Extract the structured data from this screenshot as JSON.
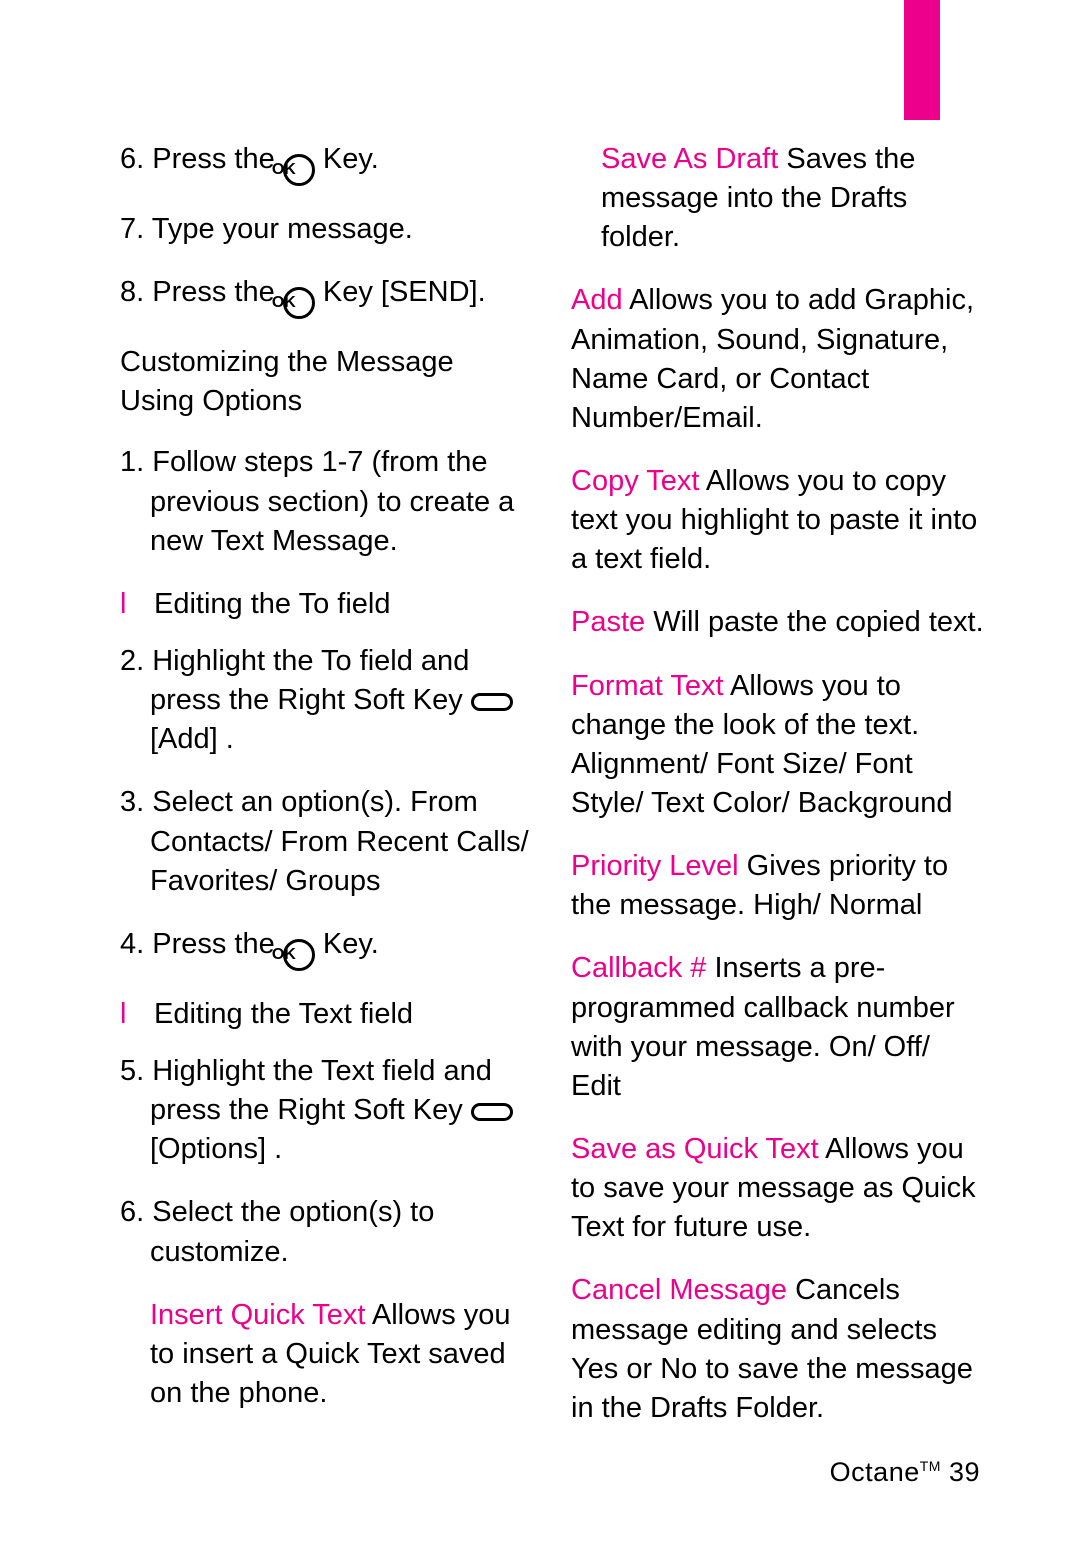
{
  "left": {
    "step6a": "6. Press the ",
    "step6b": " Key.",
    "step7": "7. Type your message.",
    "step8a": "8. Press the ",
    "step8b": " Key ",
    "step8c": "[SEND]",
    "step8d": ".",
    "subhead1": "Customizing the Message Using Options",
    "cstep1": "1. Follow steps 1-7 (from the previous section) to create a new Text Message.",
    "bullet1": "Editing the To field",
    "cstep2a": "2. Highlight the To field and press the Right Soft Key ",
    "cstep2b": " [Add] .",
    "cstep3": "3. Select an option(s). From Contacts/ From Recent Calls/ Favorites/ Groups",
    "cstep4a": "4. Press the ",
    "cstep4b": " Key.",
    "bullet2": "Editing the Text field",
    "cstep5a": "5. Highlight the Text field and press the Right Soft Key ",
    "cstep5b": " [Options] .",
    "cstep6": "6. Select the option(s) to customize.",
    "opt1k": "Insert Quick Text ",
    "opt1v": "Allows you to insert a Quick Text saved on the phone.",
    "opt2k": "Save As Draft  ",
    "opt2v": "Saves the message into the Drafts folder."
  },
  "right": {
    "opt3k": "Add ",
    "opt3v": " Allows you to add Graphic, Animation, Sound, Signature, Name Card, or Contact Number/Email.",
    "opt4k": "Copy Text ",
    "opt4v": "Allows you to copy text you highlight to paste it into a text field.",
    "opt5k": "Paste ",
    "opt5v": "Will paste the copied text.",
    "opt6k": "Format Text ",
    "opt6v": "Allows you to change the look of the text. Alignment/ Font Size/ Font Style/ Text Color/ Background",
    "opt7k": "Priority Level ",
    "opt7v": "Gives priority to the message. High/ Normal",
    "opt8k": "Callback # ",
    "opt8v": " Inserts a pre-programmed callback number with your message. On/ Off/ Edit",
    "opt9k": "Save as Quick Text ",
    "opt9v": "Allows you to save your message as Quick Text for future use.",
    "opt10k": "Cancel Message ",
    "opt10v": "Cancels message editing and selects Yes or No to save the message in the Drafts Folder."
  },
  "footer": {
    "brand": "Octane",
    "tm": "TM",
    "page": "  39"
  },
  "icons": {
    "ok": "OK"
  }
}
